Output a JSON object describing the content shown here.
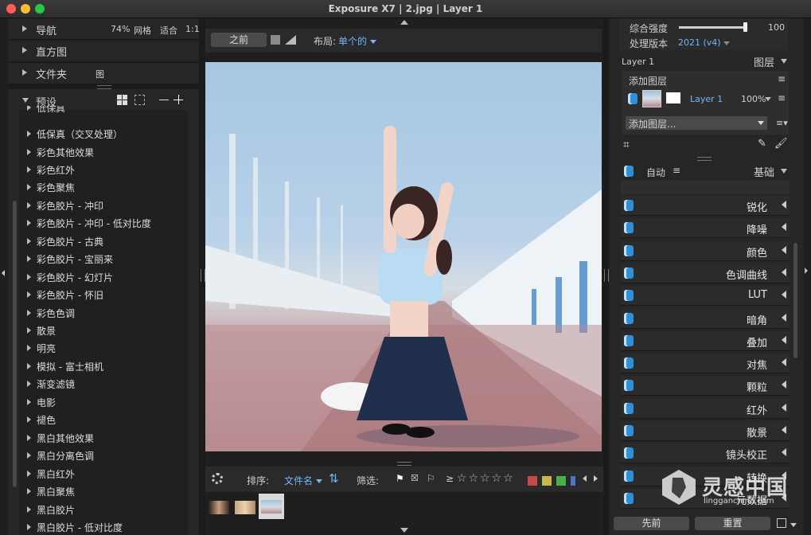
{
  "window": {
    "title": "Exposure X7 | 2.jpg | Layer 1"
  },
  "colors": {
    "close": "#ff5f57",
    "minimize": "#febc2e",
    "zoom": "#28c840",
    "accent": "#2f8fd8",
    "link": "#6fb6ff"
  },
  "nav": {
    "navigator": "导航",
    "zoom_percent": "74%",
    "grid": "网格",
    "fit": "适合",
    "one_to_one": "1:1",
    "histogram": "直方图",
    "folders": "文件夹",
    "folders_icon_label": "图"
  },
  "presets": {
    "title": "预设",
    "items": [
      "低保真",
      "低保真（交叉处理）",
      "彩色其他效果",
      "彩色红外",
      "彩色聚焦",
      "彩色胶片 - 冲印",
      "彩色胶片 - 冲印 - 低对比度",
      "彩色胶片 - 古典",
      "彩色胶片 - 宝丽来",
      "彩色胶片 - 幻灯片",
      "彩色胶片 - 怀旧",
      "彩色色调",
      "散景",
      "明亮",
      "模拟 - 富士相机",
      "渐变滤镜",
      "电影",
      "褪色",
      "黑白其他效果",
      "黑白分离色调",
      "黑白红外",
      "黑白聚焦",
      "黑白胶片",
      "黑白胶片 - 低对比度"
    ]
  },
  "center": {
    "before_button": "之前",
    "layout_label": "布局:",
    "layout_value": "单个的",
    "sort_label": "排序:",
    "sort_value": "文件名",
    "filter_label": "筛选:",
    "rating_prefix": "≥",
    "stars": [
      "☆",
      "☆",
      "☆",
      "☆",
      "☆"
    ],
    "color_labels": [
      "#c84848",
      "#c8b848",
      "#48b048",
      "#4878c8"
    ]
  },
  "right": {
    "overall_strength_label": "综合强度",
    "overall_strength_value": "100",
    "overall_strength_level": 0.97,
    "process_version_label": "处理版本",
    "process_version_value": "2021 (v4)",
    "layer_name": "Layer 1",
    "layers_title": "图层",
    "add_layer": "添加图层",
    "layer_row_name": "Layer 1",
    "layer_row_opacity": "100%",
    "add_layer_dropdown": "添加图层...",
    "auto": "自动",
    "basic": "基础",
    "adjustments": [
      "锐化",
      "降噪",
      "颜色",
      "色调曲线",
      "LUT",
      "暗角",
      "叠加",
      "对焦",
      "颗粒",
      "红外",
      "散景",
      "镜头校正",
      "转换",
      "元数据"
    ],
    "previous_button": "先前",
    "reset_button": "重置"
  },
  "watermark": {
    "brand": "灵感中国",
    "url": "lingganchina.com"
  }
}
